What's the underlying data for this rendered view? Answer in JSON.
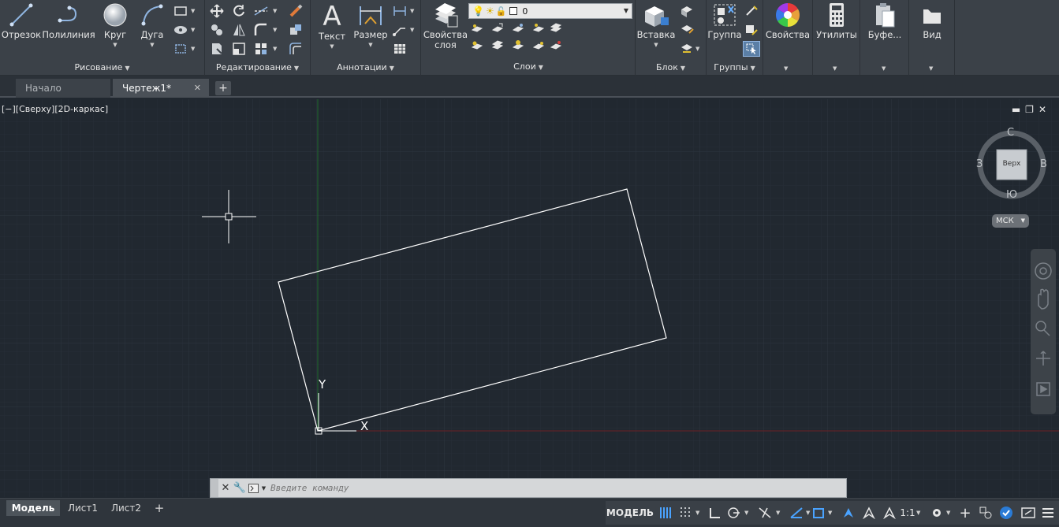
{
  "ribbon": {
    "draw": {
      "title": "Рисование",
      "line": "Отрезок",
      "polyline": "Полилиния",
      "circle": "Круг",
      "arc": "Дуга"
    },
    "modify": {
      "title": "Редактирование"
    },
    "annotation": {
      "title": "Аннотации",
      "text": "Текст",
      "dimension": "Размер"
    },
    "layers": {
      "title": "Слои",
      "properties_line1": "Свойства",
      "properties_line2": "слоя",
      "current_layer": "0"
    },
    "block": {
      "title": "Блок",
      "insert": "Вставка"
    },
    "groups": {
      "title": "Группы",
      "group": "Группа"
    },
    "properties": "Свойства",
    "utilities": "Утилиты",
    "clipboard": "Буфе...",
    "view": "Вид"
  },
  "tabs": {
    "start": "Начало",
    "drawing": "Чертеж1*"
  },
  "viewport": {
    "label": "[−][Сверху][2D-каркас]",
    "viewcube_face": "Верх",
    "north": "С",
    "south": "Ю",
    "east": "В",
    "west": "З",
    "wcs": "МСК"
  },
  "ucs": {
    "x_label": "X",
    "y_label": "Y"
  },
  "command": {
    "placeholder": "Введите команду"
  },
  "layouts": {
    "model": "Модель",
    "sheet1": "Лист1",
    "sheet2": "Лист2"
  },
  "status": {
    "space": "МОДЕЛЬ",
    "scale": "1:1"
  },
  "colors": {
    "background": "#212830",
    "ribbon": "#3b4148",
    "grid_minor": "#262e37",
    "grid_major": "#2d3641",
    "y_axis": "#1f6a2d",
    "x_axis": "#6a1f24",
    "geometry": "#ffffff"
  }
}
